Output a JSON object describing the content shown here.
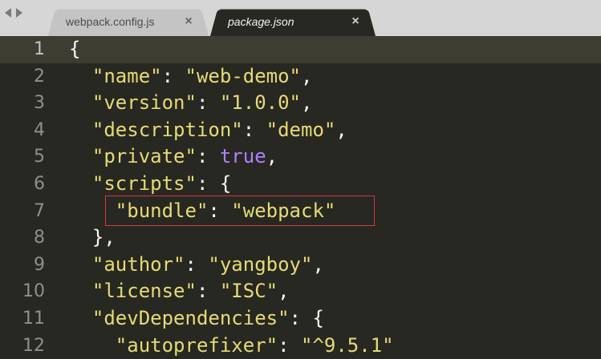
{
  "tabs": [
    {
      "label": "webpack.config.js",
      "active": false,
      "close": "×"
    },
    {
      "label": "package.json",
      "active": true,
      "close": "×"
    }
  ],
  "current_line": 1,
  "lines": [
    {
      "num": "1",
      "indent": "",
      "parts": [
        {
          "t": "{",
          "c": "p"
        }
      ]
    },
    {
      "num": "2",
      "indent": "  ",
      "parts": [
        {
          "t": "\"name\"",
          "c": "s"
        },
        {
          "t": ": ",
          "c": "p"
        },
        {
          "t": "\"web-demo\"",
          "c": "s"
        },
        {
          "t": ",",
          "c": "p"
        }
      ]
    },
    {
      "num": "3",
      "indent": "  ",
      "parts": [
        {
          "t": "\"version\"",
          "c": "s"
        },
        {
          "t": ": ",
          "c": "p"
        },
        {
          "t": "\"1.0.0\"",
          "c": "s"
        },
        {
          "t": ",",
          "c": "p"
        }
      ]
    },
    {
      "num": "4",
      "indent": "  ",
      "parts": [
        {
          "t": "\"description\"",
          "c": "s"
        },
        {
          "t": ": ",
          "c": "p"
        },
        {
          "t": "\"demo\"",
          "c": "s"
        },
        {
          "t": ",",
          "c": "p"
        }
      ]
    },
    {
      "num": "5",
      "indent": "  ",
      "parts": [
        {
          "t": "\"private\"",
          "c": "s"
        },
        {
          "t": ": ",
          "c": "p"
        },
        {
          "t": "true",
          "c": "k"
        },
        {
          "t": ",",
          "c": "p"
        }
      ]
    },
    {
      "num": "6",
      "indent": "  ",
      "parts": [
        {
          "t": "\"scripts\"",
          "c": "s"
        },
        {
          "t": ": {",
          "c": "p"
        }
      ]
    },
    {
      "num": "7",
      "indent": "    ",
      "parts": [
        {
          "t": "\"bundle\"",
          "c": "s"
        },
        {
          "t": ": ",
          "c": "p"
        },
        {
          "t": "\"webpack\"",
          "c": "s"
        }
      ]
    },
    {
      "num": "8",
      "indent": "  ",
      "parts": [
        {
          "t": "},",
          "c": "p"
        }
      ]
    },
    {
      "num": "9",
      "indent": "  ",
      "parts": [
        {
          "t": "\"author\"",
          "c": "s"
        },
        {
          "t": ": ",
          "c": "p"
        },
        {
          "t": "\"yangboy\"",
          "c": "s"
        },
        {
          "t": ",",
          "c": "p"
        }
      ]
    },
    {
      "num": "10",
      "indent": "  ",
      "parts": [
        {
          "t": "\"license\"",
          "c": "s"
        },
        {
          "t": ": ",
          "c": "p"
        },
        {
          "t": "\"ISC\"",
          "c": "s"
        },
        {
          "t": ",",
          "c": "p"
        }
      ]
    },
    {
      "num": "11",
      "indent": "  ",
      "parts": [
        {
          "t": "\"devDependencies\"",
          "c": "s"
        },
        {
          "t": ": {",
          "c": "p"
        }
      ]
    },
    {
      "num": "12",
      "indent": "    ",
      "parts": [
        {
          "t": "\"autoprefixer\"",
          "c": "s"
        },
        {
          "t": ": ",
          "c": "p"
        },
        {
          "t": "\"^9.5.1\"",
          "c": "s"
        }
      ]
    }
  ],
  "colors": {
    "background": "#272822",
    "string": "#e6db74",
    "constant": "#ae81ff",
    "plain": "#f8f8f2",
    "highlight_box": "#d9363e"
  }
}
